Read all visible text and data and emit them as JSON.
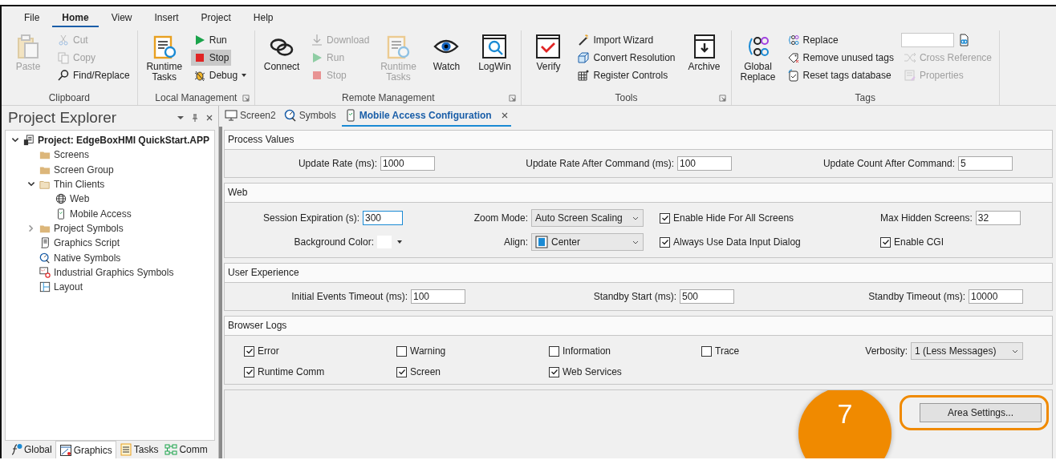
{
  "menu_tabs": [
    {
      "label": "File",
      "selected": false
    },
    {
      "label": "Home",
      "selected": true
    },
    {
      "label": "View",
      "selected": false
    },
    {
      "label": "Insert",
      "selected": false
    },
    {
      "label": "Project",
      "selected": false
    },
    {
      "label": "Help",
      "selected": false
    }
  ],
  "ribbon_groups": [
    {
      "label": "Clipboard",
      "dialog_launcher": false,
      "items": [
        {
          "kind": "large",
          "label": "Paste",
          "disabled": true
        },
        {
          "kind": "column",
          "entries": [
            {
              "kind": "button",
              "label": "Cut",
              "disabled": true,
              "selected": false,
              "dropdown": false
            },
            {
              "kind": "button",
              "label": "Copy",
              "disabled": true,
              "selected": false,
              "dropdown": false
            },
            {
              "kind": "button",
              "label": "Find/Replace",
              "disabled": false,
              "selected": false,
              "dropdown": false
            }
          ]
        }
      ]
    },
    {
      "label": "Local Management",
      "dialog_launcher": true,
      "items": [
        {
          "kind": "large",
          "label": "Runtime Tasks",
          "disabled": false
        },
        {
          "kind": "column",
          "entries": [
            {
              "kind": "button",
              "label": "Run",
              "disabled": false,
              "selected": false,
              "dropdown": false
            },
            {
              "kind": "button",
              "label": "Stop",
              "disabled": false,
              "selected": true,
              "dropdown": false
            },
            {
              "kind": "button",
              "label": "Debug",
              "disabled": false,
              "selected": false,
              "dropdown": true
            }
          ]
        }
      ]
    },
    {
      "label": "Remote Management",
      "dialog_launcher": true,
      "items": [
        {
          "kind": "large",
          "label": "Connect",
          "disabled": false
        },
        {
          "kind": "column",
          "entries": [
            {
              "kind": "button",
              "label": "Download",
              "disabled": true,
              "selected": false,
              "dropdown": false
            },
            {
              "kind": "button",
              "label": "Run",
              "disabled": true,
              "selected": false,
              "dropdown": false
            },
            {
              "kind": "button",
              "label": "Stop",
              "disabled": true,
              "selected": false,
              "dropdown": false
            }
          ]
        },
        {
          "kind": "large",
          "label": "Runtime Tasks",
          "disabled": true
        },
        {
          "kind": "large",
          "label": "Watch",
          "disabled": false
        },
        {
          "kind": "large",
          "label": "LogWin",
          "disabled": false
        }
      ]
    },
    {
      "label": "Tools",
      "dialog_launcher": true,
      "items": [
        {
          "kind": "large",
          "label": "Verify",
          "disabled": false
        },
        {
          "kind": "column",
          "entries": [
            {
              "kind": "button",
              "label": "Import Wizard",
              "disabled": false,
              "selected": false,
              "dropdown": false
            },
            {
              "kind": "button",
              "label": "Convert Resolution",
              "disabled": false,
              "selected": false,
              "dropdown": false
            },
            {
              "kind": "button",
              "label": "Register Controls",
              "disabled": false,
              "selected": false,
              "dropdown": false
            }
          ]
        },
        {
          "kind": "large",
          "label": "Archive",
          "disabled": false
        }
      ]
    },
    {
      "label": "Tags",
      "dialog_launcher": false,
      "items": [
        {
          "kind": "large",
          "label": "Global Replace",
          "disabled": false
        },
        {
          "kind": "column",
          "entries": [
            {
              "kind": "button",
              "label": "Replace",
              "disabled": false,
              "selected": false,
              "dropdown": false
            },
            {
              "kind": "button",
              "label": "Remove unused tags",
              "disabled": false,
              "selected": false,
              "dropdown": false
            },
            {
              "kind": "button",
              "label": "Reset tags database",
              "disabled": false,
              "selected": false,
              "dropdown": false
            }
          ]
        },
        {
          "kind": "column",
          "entries": [
            {
              "kind": "field"
            },
            {
              "kind": "button",
              "label": "Cross Reference",
              "disabled": true,
              "selected": false,
              "dropdown": false
            },
            {
              "kind": "button",
              "label": "Properties",
              "disabled": true,
              "selected": false,
              "dropdown": false
            }
          ]
        }
      ]
    }
  ],
  "explorer": {
    "title": "Project Explorer",
    "tree": [
      {
        "label": "Project: EdgeBoxHMI QuickStart.APP",
        "expandable": true,
        "expanded": true,
        "children": [
          {
            "label": "Screens",
            "expandable": false,
            "expanded": false
          },
          {
            "label": "Screen Group",
            "expandable": false,
            "expanded": false
          },
          {
            "label": "Thin Clients",
            "expandable": true,
            "expanded": true,
            "children": [
              {
                "label": "Web",
                "expandable": false,
                "expanded": false
              },
              {
                "label": "Mobile Access",
                "expandable": false,
                "expanded": false
              }
            ]
          },
          {
            "label": "Project Symbols",
            "expandable": true,
            "expanded": false
          },
          {
            "label": "Graphics Script",
            "expandable": false,
            "expanded": false
          },
          {
            "label": "Native Symbols",
            "expandable": false,
            "expanded": false
          },
          {
            "label": "Industrial Graphics Symbols",
            "expandable": false,
            "expanded": false
          },
          {
            "label": "Layout",
            "expandable": false,
            "expanded": false
          }
        ]
      }
    ],
    "bottom_tabs": [
      {
        "label": "Global",
        "selected": false
      },
      {
        "label": "Graphics",
        "selected": true
      },
      {
        "label": "Tasks",
        "selected": false
      },
      {
        "label": "Comm",
        "selected": false
      }
    ]
  },
  "document_tabs": [
    {
      "label": "Screen2",
      "selected": false
    },
    {
      "label": "Symbols",
      "selected": false
    },
    {
      "label": "Mobile Access Configuration",
      "selected": true
    }
  ],
  "sections": [
    {
      "title": "Process Values",
      "rows": [
        [
          {
            "kind": "text",
            "label": "Update Rate (ms):",
            "value": "1000",
            "focused": false
          },
          {
            "kind": "text",
            "label": "Update Rate After Command (ms):",
            "value": "100",
            "focused": false
          },
          {
            "kind": "text",
            "label": "Update Count After Command:",
            "value": "5",
            "focused": false
          }
        ]
      ]
    },
    {
      "title": "Web",
      "rows": [
        [
          {
            "kind": "text",
            "label": "Session Expiration (s):",
            "value": "300",
            "focused": true
          },
          {
            "kind": "dropdown",
            "label": "Zoom Mode:",
            "value": "Auto Screen Scaling"
          },
          {
            "kind": "checkbox",
            "label": "Enable Hide For All Screens",
            "checked": true
          },
          {
            "kind": "text",
            "label": "Max Hidden Screens:",
            "value": "32",
            "focused": false
          }
        ],
        [
          {
            "kind": "color",
            "label": "Background Color:"
          },
          {
            "kind": "dropdown",
            "label": "Align:",
            "value": "Center"
          },
          {
            "kind": "checkbox",
            "label": "Always Use Data Input Dialog",
            "checked": true
          },
          {
            "kind": "checkbox",
            "label": "Enable CGI",
            "checked": true
          }
        ]
      ]
    },
    {
      "title": "User Experience",
      "rows": [
        [
          {
            "kind": "text",
            "label": "Initial Events Timeout (ms):",
            "value": "100",
            "focused": false
          },
          {
            "kind": "text",
            "label": "Standby Start (ms):",
            "value": "500",
            "focused": false
          },
          {
            "kind": "text",
            "label": "Standby Timeout (ms):",
            "value": "10000",
            "focused": false
          }
        ]
      ]
    },
    {
      "title": "Browser Logs",
      "rows": [
        [
          {
            "kind": "checkbox",
            "label": "Error",
            "checked": true
          },
          {
            "kind": "checkbox",
            "label": "Warning",
            "checked": false
          },
          {
            "kind": "checkbox",
            "label": "Information",
            "checked": false
          },
          {
            "kind": "checkbox",
            "label": "Trace",
            "checked": false
          },
          {
            "kind": "dropdown",
            "label": "Verbosity:",
            "value": "1 (Less Messages)"
          }
        ],
        [
          {
            "kind": "checkbox",
            "label": "Runtime Comm",
            "checked": true
          },
          {
            "kind": "checkbox",
            "label": "Screen",
            "checked": true
          },
          {
            "kind": "checkbox",
            "label": "Web Services",
            "checked": true
          }
        ]
      ]
    }
  ],
  "footer": {
    "button": {
      "label": "Area Settings...",
      "highlighted": true
    },
    "step_badge": "7"
  }
}
